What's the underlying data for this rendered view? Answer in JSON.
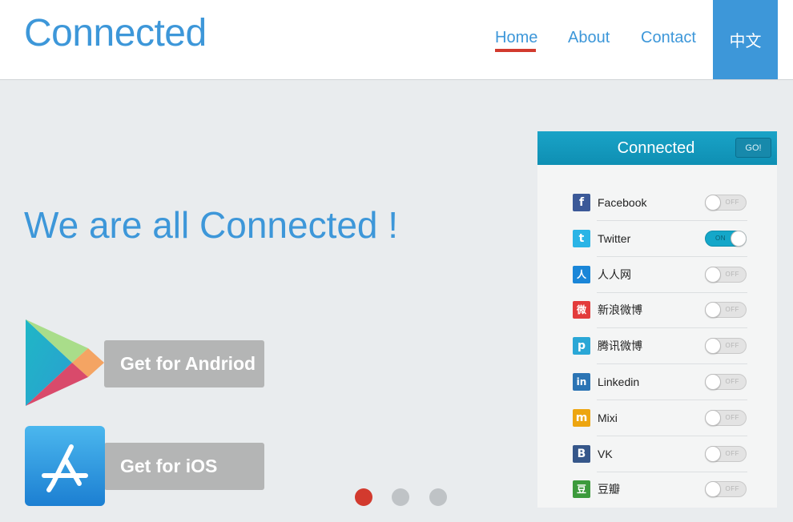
{
  "header": {
    "logo": "Connected",
    "nav": [
      {
        "label": "Home",
        "active": true
      },
      {
        "label": "About"
      },
      {
        "label": "Contact"
      }
    ],
    "language_button": "中文"
  },
  "hero": {
    "title": "We are all Connected !",
    "android_button": "Get for Andriod",
    "ios_button": "Get for iOS"
  },
  "carousel": {
    "slides": 3,
    "active_index": 0
  },
  "panel": {
    "title": "Connected",
    "go_button": "GO!",
    "networks": [
      {
        "label": "Facebook",
        "icon": "facebook-icon",
        "glyph": "f",
        "color": "#3b5998",
        "state": "OFF"
      },
      {
        "label": "Twitter",
        "icon": "twitter-icon",
        "glyph": "t",
        "color": "#2ab4e6",
        "state": "ON"
      },
      {
        "label": "人人网",
        "icon": "renren-icon",
        "glyph": "人",
        "color": "#1a86d8",
        "state": "OFF"
      },
      {
        "label": "新浪微博",
        "icon": "weibo-icon",
        "glyph": "微",
        "color": "#e33b3b",
        "state": "OFF"
      },
      {
        "label": "腾讯微博",
        "icon": "tencent-weibo-icon",
        "glyph": "p",
        "color": "#2aa7d6",
        "state": "OFF"
      },
      {
        "label": "Linkedin",
        "icon": "linkedin-icon",
        "glyph": "in",
        "color": "#2b74b4",
        "state": "OFF"
      },
      {
        "label": "Mixi",
        "icon": "mixi-icon",
        "glyph": "m",
        "color": "#eda510",
        "state": "OFF"
      },
      {
        "label": "VK",
        "icon": "vk-icon",
        "glyph": "B",
        "color": "#36578a",
        "state": "OFF"
      },
      {
        "label": "豆瓣",
        "icon": "douban-icon",
        "glyph": "豆",
        "color": "#3c9a3c",
        "state": "OFF"
      }
    ]
  },
  "colors": {
    "accent": "#3d97d9",
    "active_indicator": "#d23a2e",
    "panel_header": "#1aa3c7"
  }
}
